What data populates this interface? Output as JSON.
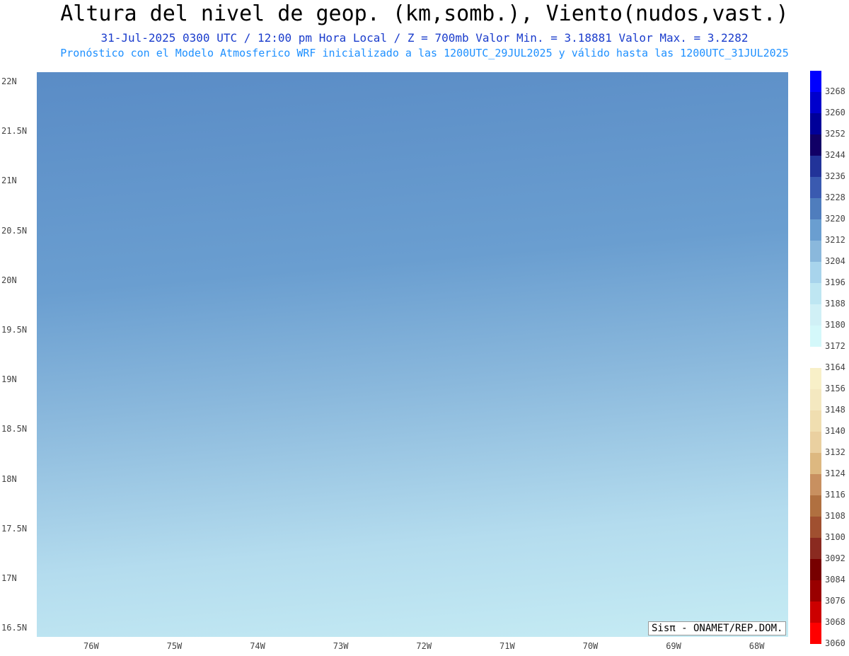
{
  "title": "Altura del nivel de geop. (km,somb.), Viento(nudos,vast.)",
  "line2": "31-Jul-2025  0300 UTC / 12:00 pm Hora Local / Z = 700mb    Valor Min. = 3.18881  Valor Max. = 3.2282",
  "line3": "Pronóstico con el Modelo Atmosferico WRF inicializado a las 1200UTC_29JUL2025 y válido hasta las  1200UTC_31JUL2025",
  "lats": [
    "22N",
    "21.5N",
    "21N",
    "20.5N",
    "20N",
    "19.5N",
    "19N",
    "18.5N",
    "18N",
    "17.5N",
    "17N",
    "16.5N"
  ],
  "lons": [
    "76W",
    "75W",
    "74W",
    "73W",
    "72W",
    "71W",
    "70W",
    "69W",
    "68W"
  ],
  "scale": [
    "3268",
    "3260",
    "3252",
    "3244",
    "3236",
    "3228",
    "3220",
    "3212",
    "3204",
    "3196",
    "3188",
    "3180",
    "3172",
    "3164",
    "3156",
    "3148",
    "3140",
    "3132",
    "3124",
    "3116",
    "3108",
    "3100",
    "3092",
    "3084",
    "3076",
    "3068",
    "3060"
  ],
  "credit": "Sisπ - ONAMET/REP.DOM."
}
